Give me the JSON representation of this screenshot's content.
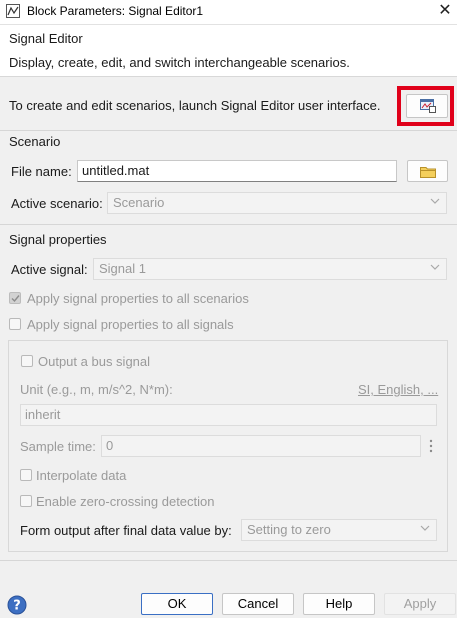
{
  "window": {
    "title": "Block Parameters: Signal Editor1",
    "icon": "simulink-block-icon",
    "close_glyph": "✕"
  },
  "header": {
    "title": "Signal Editor",
    "description": "Display, create, edit, and switch interchangeable scenarios."
  },
  "launch": {
    "text": "To create and edit scenarios, launch Signal Editor user interface.",
    "button_icon": "signal-editor-launch-icon",
    "highlight_color": "#e0001a"
  },
  "scenario": {
    "section_title": "Scenario",
    "file_name_label": "File name:",
    "file_name_value": "untitled.mat",
    "browse_icon": "folder-icon",
    "active_scenario_label": "Active scenario:",
    "active_scenario_value": "Scenario"
  },
  "signal_properties": {
    "section_title": "Signal properties",
    "active_signal_label": "Active signal:",
    "active_signal_value": "Signal 1",
    "apply_all_scenarios_label": "Apply signal properties to all scenarios",
    "apply_all_scenarios_checked": true,
    "apply_all_signals_label": "Apply signal properties to all signals",
    "apply_all_signals_checked": false,
    "output_bus_label": "Output a bus signal",
    "output_bus_checked": false,
    "unit_label": "Unit (e.g., m, m/s^2, N*m):",
    "unit_link": "SI, English, ...",
    "unit_value": "inherit",
    "sample_time_label": "Sample time:",
    "sample_time_value": "0",
    "interpolate_label": "Interpolate data",
    "interpolate_checked": false,
    "zero_crossing_label": "Enable zero-crossing detection",
    "zero_crossing_checked": false,
    "form_output_label": "Form output after final data value by:",
    "form_output_value": "Setting to zero"
  },
  "footer": {
    "help_icon": "help-icon",
    "ok": "OK",
    "cancel": "Cancel",
    "help": "Help",
    "apply": "Apply"
  }
}
